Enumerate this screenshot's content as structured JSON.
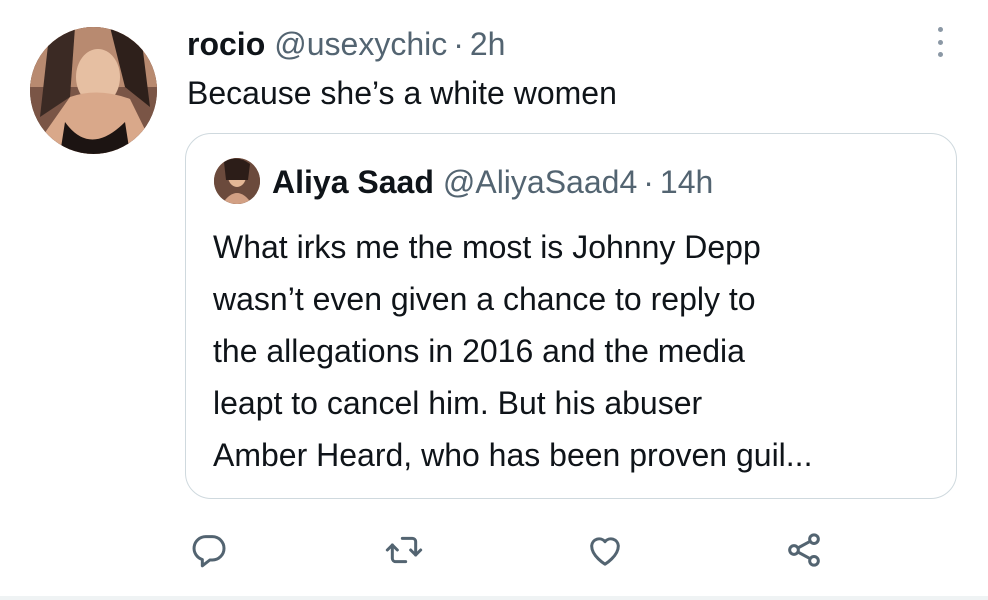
{
  "tweet": {
    "name": "rocio",
    "handle": "@usexychic",
    "separator": "·",
    "time": "2h",
    "text": "Because she’s a white women"
  },
  "quoted": {
    "name": "Aliya Saad",
    "handle": "@AliyaSaad4",
    "separator": "·",
    "time": "14h",
    "lines": [
      "What irks me the most is Johnny Depp",
      "wasn’t even given a chance to reply to",
      "the allegations in 2016 and the media",
      "leapt to cancel him. But his abuser",
      "Amber Heard, who has been proven guil..."
    ]
  },
  "icons": {
    "reply": "reply-icon",
    "retweet": "retweet-icon",
    "like": "heart-icon",
    "share": "share-icon",
    "more": "more-dots-icon"
  },
  "colors": {
    "text": "#0f1419",
    "secondary": "#536471",
    "border": "#cfd9de",
    "icon": "#536471"
  }
}
